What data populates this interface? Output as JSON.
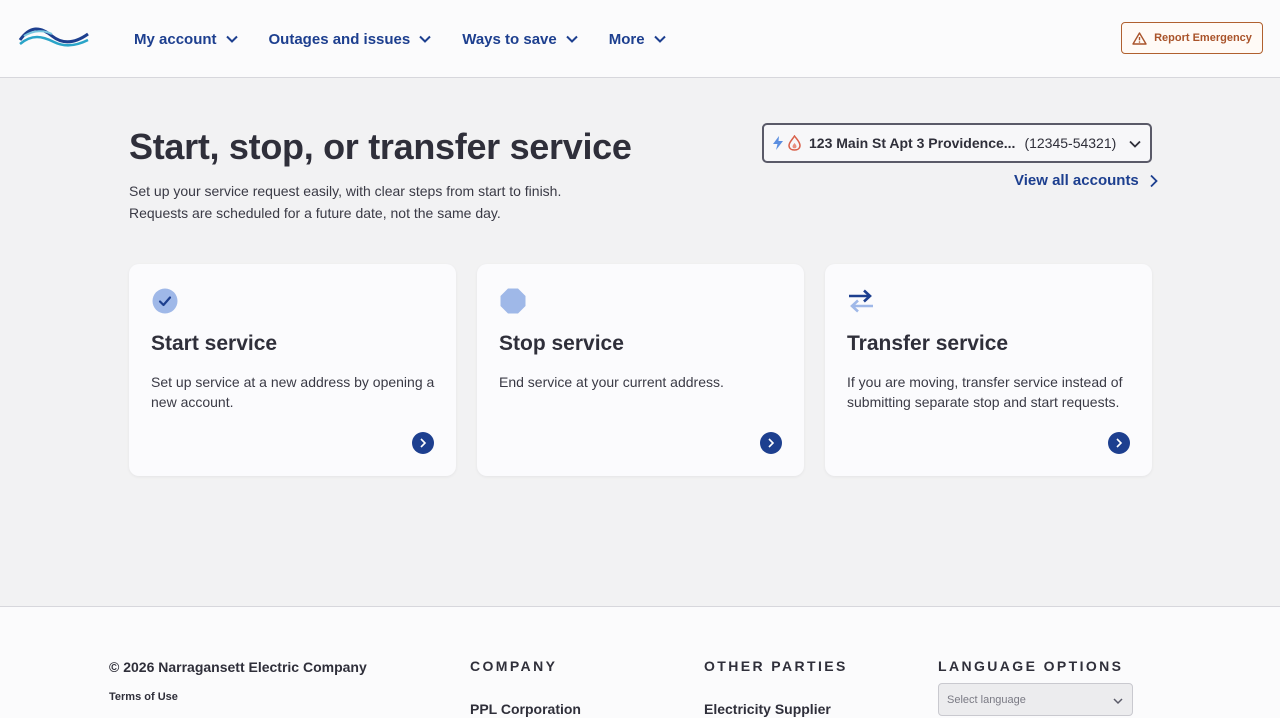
{
  "header": {
    "nav": [
      {
        "label": "My account"
      },
      {
        "label": "Outages and issues"
      },
      {
        "label": "Ways to save"
      },
      {
        "label": "More"
      }
    ],
    "report_emergency": "Report Emergency"
  },
  "hero": {
    "title": "Start, stop, or transfer service",
    "subtitle_line1": "Set up your service request easily, with clear steps from start to finish.",
    "subtitle_line2": "Requests are scheduled for a future date, not the same day."
  },
  "account": {
    "address": "123 Main St Apt 3 Providence...",
    "number": "(12345-54321)",
    "view_all": "View all accounts"
  },
  "cards": [
    {
      "title": "Start service",
      "description": "Set up service at a new address by opening a new account.",
      "icon": "check-circle-icon"
    },
    {
      "title": "Stop service",
      "description": "End service at your current address.",
      "icon": "stop-octagon-icon"
    },
    {
      "title": "Transfer service",
      "description": "If you are moving, transfer service instead of submitting separate stop and start requests.",
      "icon": "transfer-arrows-icon"
    }
  ],
  "footer": {
    "copyright": "© 2026 Narragansett Electric Company",
    "terms": "Terms of Use",
    "company_heading": "COMPANY",
    "company_link": "PPL Corporation",
    "other_heading": "OTHER PARTIES",
    "other_link": "Electricity Supplier",
    "language_heading": "LANGUAGE OPTIONS",
    "language_placeholder": "Select language"
  },
  "colors": {
    "brand_blue": "#1d3f8f",
    "emergency": "#a9532a",
    "background": "#f2f2f3"
  }
}
